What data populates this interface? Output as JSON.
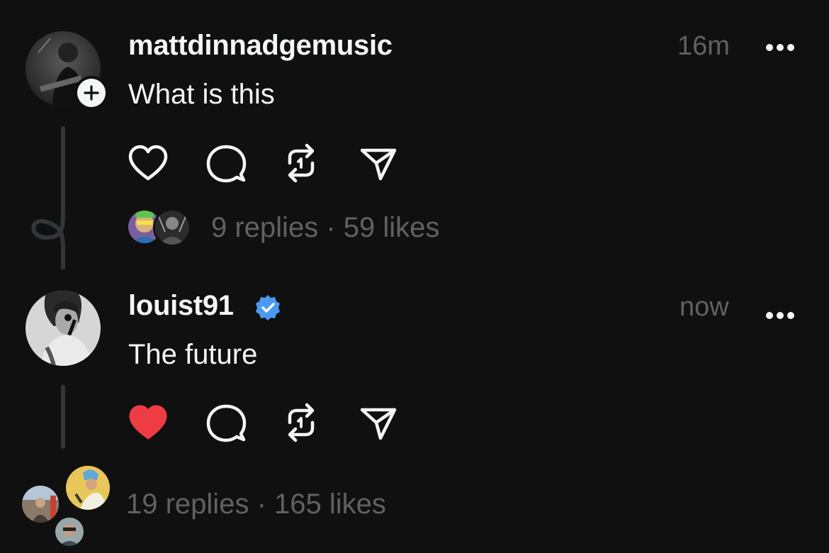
{
  "posts": [
    {
      "username": "mattdinnadgemusic",
      "verified": false,
      "text": "What is this",
      "time": "16m",
      "liked": false,
      "replies_summary": "9 replies",
      "separator": "·",
      "likes_summary": "59 likes"
    },
    {
      "username": "louist91",
      "verified": true,
      "text": "The future",
      "time": "now",
      "liked": true,
      "replies_summary": "19 replies",
      "separator": "·",
      "likes_summary": "165 likes"
    }
  ],
  "more_label": "•••",
  "colors": {
    "background": "#101010",
    "text": "#f3f5f7",
    "muted": "#616161",
    "like_red": "#ef3b44",
    "verified_blue": "#4a9af4",
    "thread_line": "#333638"
  },
  "icons": [
    "heart-icon",
    "comment-icon",
    "repost-icon",
    "share-icon",
    "verified-badge-icon",
    "plus-icon",
    "more-icon"
  ]
}
